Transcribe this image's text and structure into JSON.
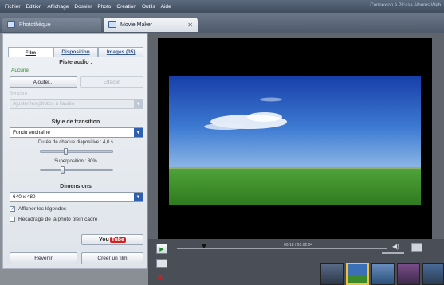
{
  "menu": {
    "items": [
      "Fichier",
      "Edition",
      "Affichage",
      "Dossier",
      "Photo",
      "Création",
      "Outils",
      "Aide"
    ],
    "right_link": "Connexion à Picasa Albums Web"
  },
  "tabs": [
    {
      "label": "Photothèque",
      "active": false
    },
    {
      "label": "Movie Maker",
      "active": true
    }
  ],
  "left_panel": {
    "subtabs": [
      "Film",
      "Disposition",
      "Images (35)"
    ],
    "audio_title": "Piste audio :",
    "audio_value": "Aucune",
    "add_button": "Ajouter...",
    "remove_button": "Effacer",
    "sync_label": "Synchro :",
    "sync_select": "Ajuster les photos à l'audio",
    "transition_title": "Style de transition",
    "transition_select": "Fondu enchaîné",
    "duration_label": "Durée de chaque diapositive : 4,0 s",
    "overlap_label": "Superposition : 30%",
    "duration_value": 0.35,
    "overlap_value": 0.3,
    "dimensions_title": "Dimensions",
    "dimensions_select": "640 x 480",
    "show_captions": "Afficher les légendes",
    "crop_photos": "Recadrage de la photo plein cadre",
    "show_captions_checked": true,
    "crop_photos_checked": false,
    "youtube_you": "You",
    "youtube_tube": "Tube",
    "exit_button": "Revenir",
    "create_button": "Créer un film"
  },
  "player": {
    "timecode": "00:18 / 00:02:04",
    "play_icon": "play-icon",
    "volume_icon": "speaker-icon"
  },
  "colors": {
    "accent": "#2f5fb0",
    "sky_top": "#1c45b4",
    "grass": "#3f9a2c"
  }
}
